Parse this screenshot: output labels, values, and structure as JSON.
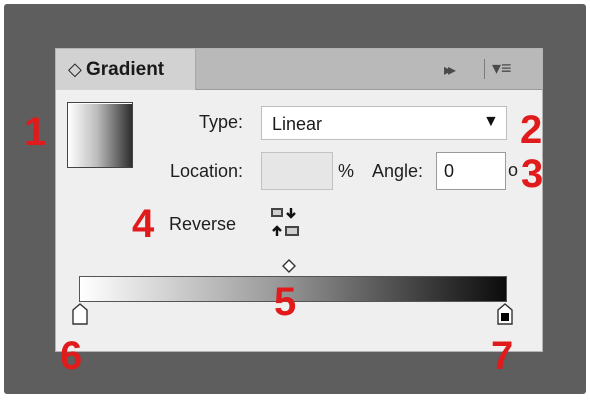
{
  "panel": {
    "tab_label": "Gradient",
    "tab_arrows": "◇",
    "collapse_icon": "▸▸",
    "menu_icon": "▾≡"
  },
  "type": {
    "label": "Type:",
    "value": "Linear"
  },
  "location": {
    "label": "Location:",
    "value": "",
    "unit": "%"
  },
  "angle": {
    "label": "Angle:",
    "value": "0",
    "unit": "o"
  },
  "reverse": {
    "label": "Reverse"
  },
  "callouts": [
    "1",
    "2",
    "3",
    "4",
    "5",
    "6",
    "7"
  ],
  "colors": {
    "callout": "#e11b1b",
    "panel_bg": "#efefef",
    "frame": "#5e5e5e"
  }
}
